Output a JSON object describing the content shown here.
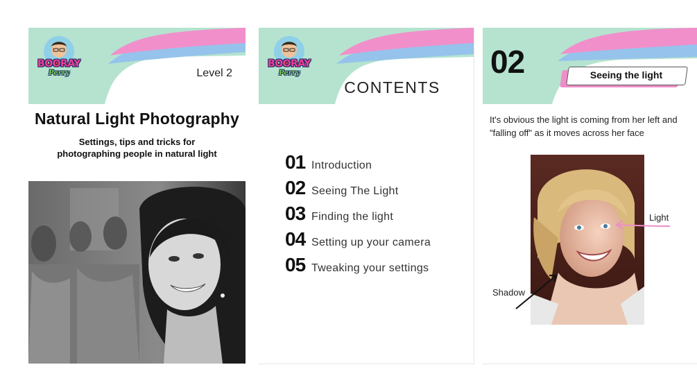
{
  "colors": {
    "mint": "#b5e3cf",
    "pink": "#f18fcb",
    "blue": "#95c3ec",
    "accent_pink": "#ef8dc8",
    "text_dark": "#111111"
  },
  "logo": {
    "name": "BOORAY",
    "sub": "Perry"
  },
  "page1": {
    "level": "Level 2",
    "title": "Natural Light Photography",
    "subtitle": "Settings, tips and tricks for photographing people in natural light"
  },
  "page2": {
    "heading": "CONTENTS",
    "items": [
      {
        "num": "01",
        "label": "Introduction"
      },
      {
        "num": "02",
        "label": "Seeing The Light"
      },
      {
        "num": "03",
        "label": "Finding the light"
      },
      {
        "num": "04",
        "label": "Setting up your camera"
      },
      {
        "num": "05",
        "label": "Tweaking your settings"
      }
    ]
  },
  "page3": {
    "number": "02",
    "tag": "Seeing the light",
    "description": "It's obvious the light is coming from her left and \"falling off\" as it moves across her face",
    "label_light": "Light",
    "label_shadow": "Shadow"
  }
}
